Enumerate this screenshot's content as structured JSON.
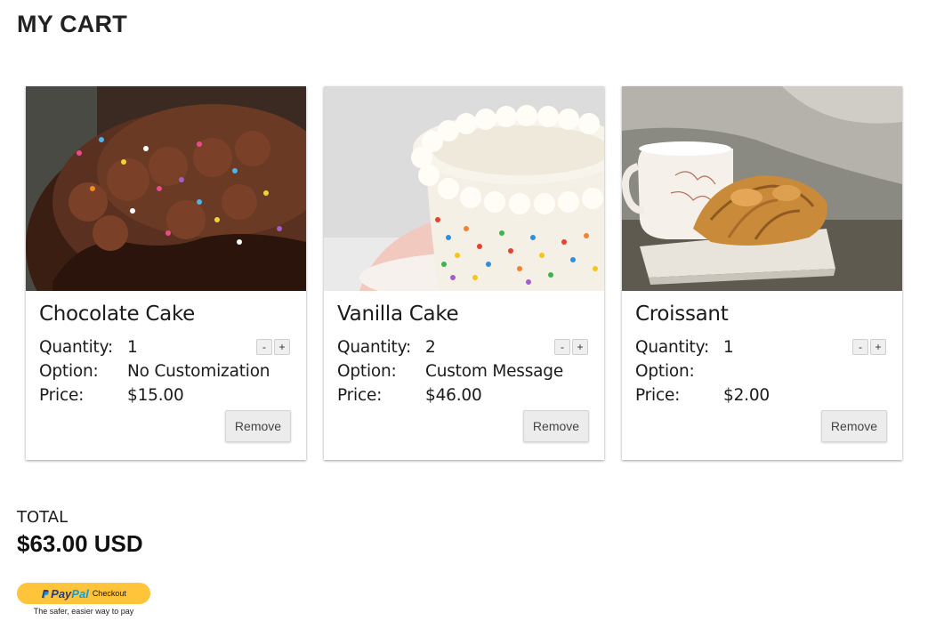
{
  "page_title": "MY CART",
  "items": [
    {
      "name": "Chocolate Cake",
      "image": "chocolate-cake-photo",
      "quantity_label": "Quantity:",
      "quantity": "1",
      "option_label": "Option:",
      "option": "No Customization",
      "price_label": "Price:",
      "price": "$15.00",
      "decrement_label": "-",
      "increment_label": "+",
      "remove_label": "Remove"
    },
    {
      "name": "Vanilla Cake",
      "image": "vanilla-sprinkle-cake-photo",
      "quantity_label": "Quantity:",
      "quantity": "2",
      "option_label": "Option:",
      "option": "Custom Message",
      "price_label": "Price:",
      "price": "$46.00",
      "decrement_label": "-",
      "increment_label": "+",
      "remove_label": "Remove"
    },
    {
      "name": "Croissant",
      "image": "croissant-and-mug-photo",
      "quantity_label": "Quantity:",
      "quantity": "1",
      "option_label": "Option:",
      "option": "",
      "price_label": "Price:",
      "price": "$2.00",
      "decrement_label": "-",
      "increment_label": "+",
      "remove_label": "Remove"
    }
  ],
  "total": {
    "label": "TOTAL",
    "value": "$63.00 USD"
  },
  "paypal": {
    "brand_pay": "Pay",
    "brand_pal": "Pal",
    "button_label": "Checkout",
    "tagline": "The safer, easier way to pay",
    "color": "#ffc439"
  }
}
